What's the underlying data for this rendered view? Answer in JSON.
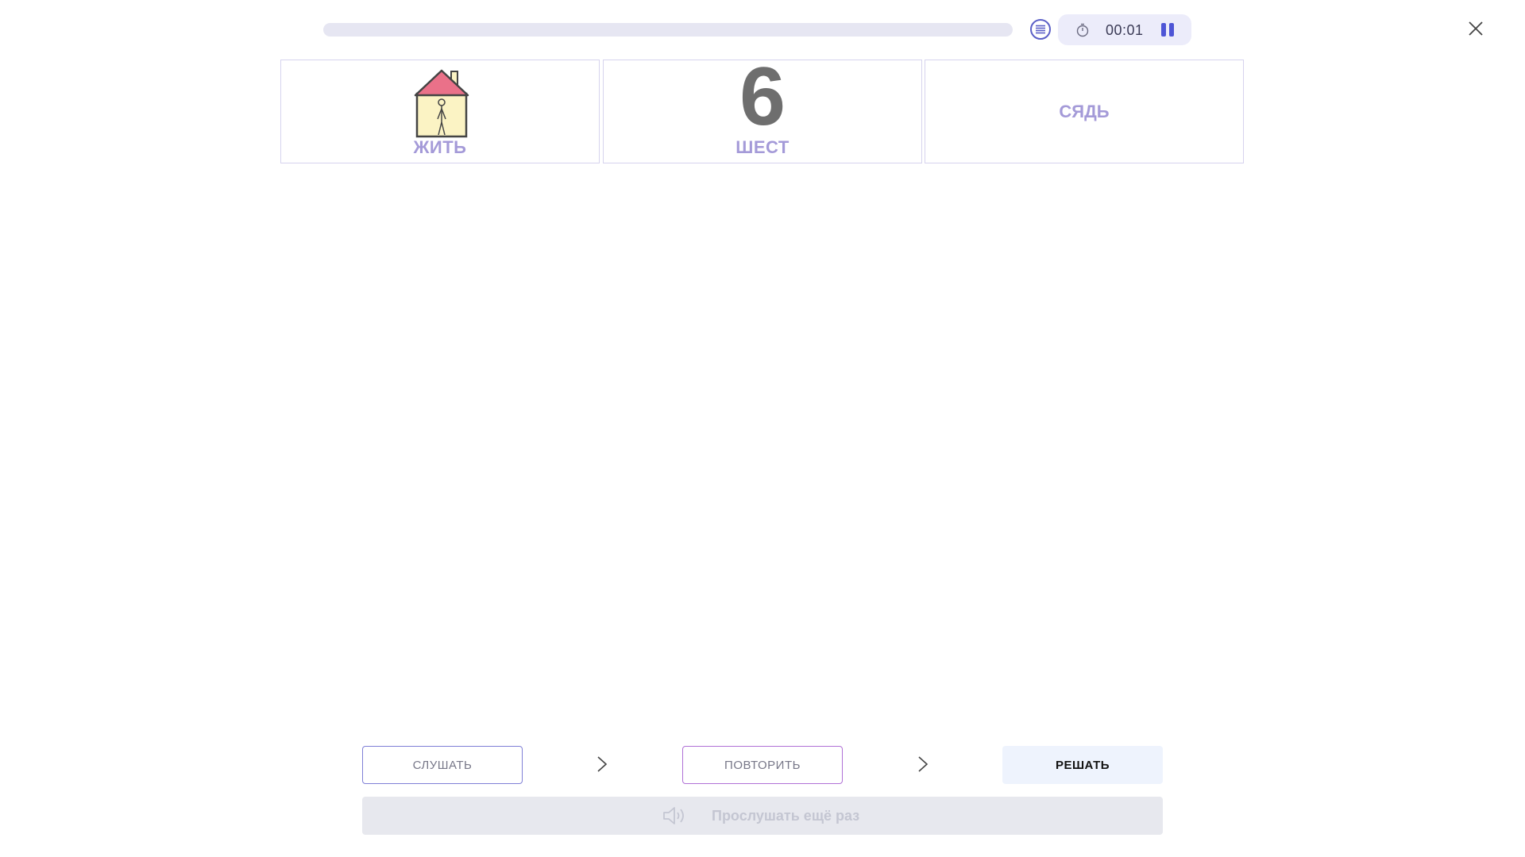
{
  "header": {
    "progress": 0,
    "timer": "00:01"
  },
  "cards": [
    {
      "label": "ЖИТЬ",
      "image": "house-with-person"
    },
    {
      "digit": "6",
      "label": "ШЕСТ"
    },
    {
      "label": "СЯДЬ"
    }
  ],
  "steps": {
    "listen": "СЛУШАТЬ",
    "repeat": "ПОВТОРИТЬ",
    "solve": "РЕШАТЬ"
  },
  "listen_again": {
    "label": "Прослушать ещё раз",
    "icon": "speaker-icon"
  },
  "colors": {
    "accent": "#4e55d6",
    "card_label": "#a49ad8",
    "card_border": "#d6d3ee"
  }
}
